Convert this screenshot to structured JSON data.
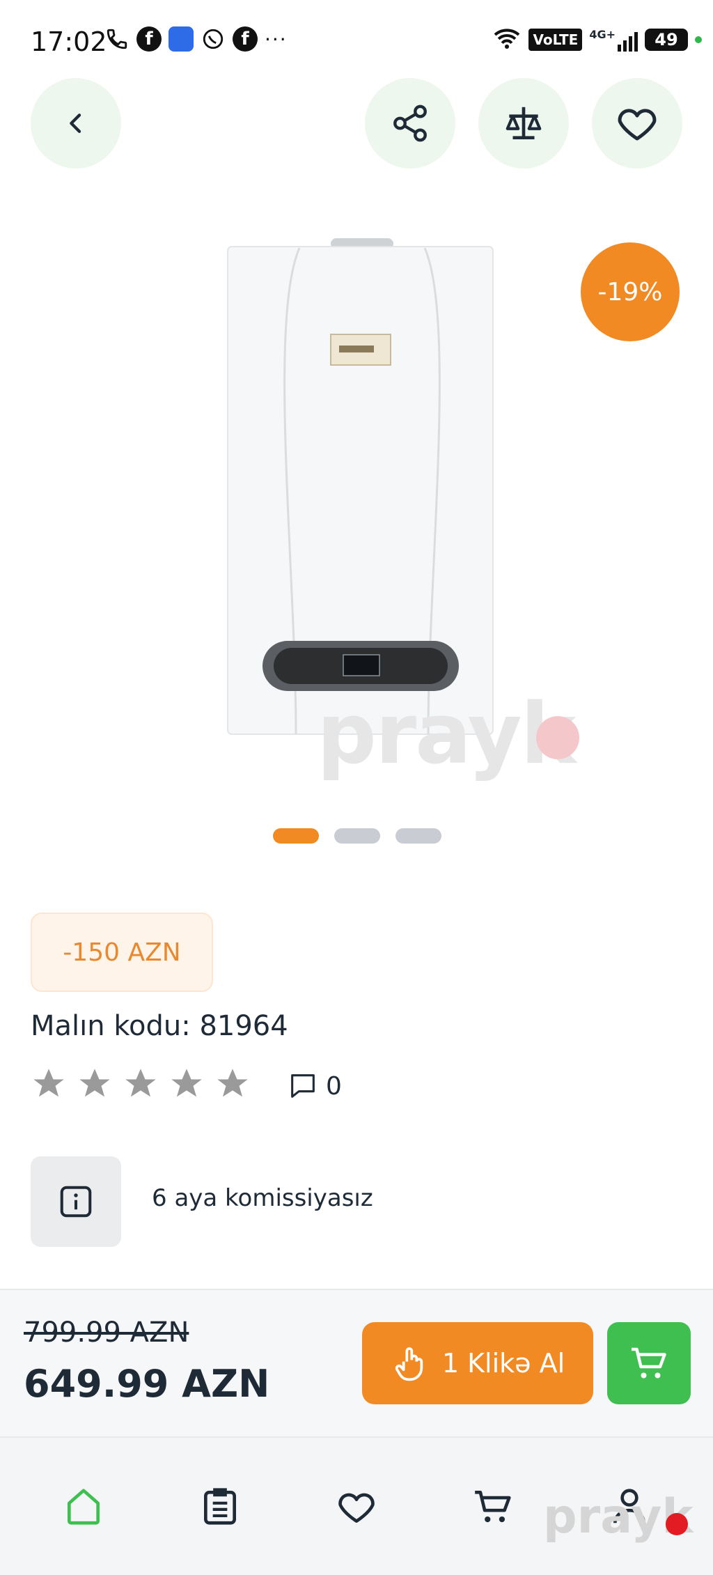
{
  "status_bar": {
    "time": "17:02",
    "network": "4G+",
    "volte": "VoLTE",
    "battery": "49"
  },
  "product": {
    "discount_badge": "-19%",
    "watermark": "prayk",
    "image_count": 3,
    "active_image": 1,
    "discount_amount": "-150 AZN",
    "code_label": "Malın kodu: 81964",
    "rating": 0,
    "rating_max": 5,
    "comments_count": "0",
    "installment_text": "6 aya komissiyasız"
  },
  "price_bar": {
    "old_price": "799.99 AZN",
    "new_price": "649.99 AZN",
    "one_click_label": "1 Klikə Al"
  },
  "nav": {
    "items": [
      "home",
      "catalog",
      "favorites",
      "cart",
      "profile"
    ],
    "active": "home",
    "watermark": "prayk"
  },
  "colors": {
    "accent_orange": "#f28a24",
    "accent_green": "#3fbf4f",
    "btn_bg": "#eef7ee"
  }
}
